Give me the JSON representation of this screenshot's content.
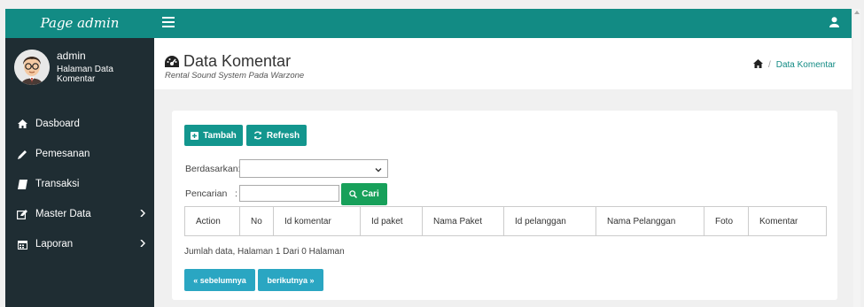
{
  "sidebar": {
    "brand": "Page admin",
    "user_name": "admin",
    "user_sub": "Halaman Data Komentar",
    "items": [
      {
        "label": "Dasboard",
        "icon": "home-icon",
        "has_children": false
      },
      {
        "label": "Pemesanan",
        "icon": "pencil-icon",
        "has_children": false
      },
      {
        "label": "Transaksi",
        "icon": "book-icon",
        "has_children": false
      },
      {
        "label": "Master Data",
        "icon": "edit-icon",
        "has_children": true
      },
      {
        "label": "Laporan",
        "icon": "calendar-icon",
        "has_children": true
      }
    ]
  },
  "header": {
    "title": "Data Komentar",
    "subtitle": "Rental Sound System Pada Warzone",
    "breadcrumb": {
      "separator": "/",
      "current": "Data Komentar"
    }
  },
  "toolbar": {
    "add_label": "Tambah",
    "refresh_label": "Refresh"
  },
  "filter": {
    "by_label": "Berdasarkan",
    "by_value": "",
    "search_label": "Pencarian",
    "search_value": "",
    "search_button": "Cari",
    "colon": ":"
  },
  "table": {
    "columns": [
      "Action",
      "No",
      "Id komentar",
      "Id paket",
      "Nama Paket",
      "Id pelanggan",
      "Nama Pelanggan",
      "Foto",
      "Komentar"
    ],
    "rows": []
  },
  "pagination": {
    "info": "Jumlah data, Halaman 1 Dari 0 Halaman",
    "prev_label": "« sebelumnya",
    "next_label": "berikutnya »"
  },
  "colors": {
    "brand": "#128b84",
    "sidebar_bg": "#1f2d33",
    "button_teal": "#13968e",
    "button_green": "#17a05a",
    "button_blue": "#2aa6c2"
  }
}
